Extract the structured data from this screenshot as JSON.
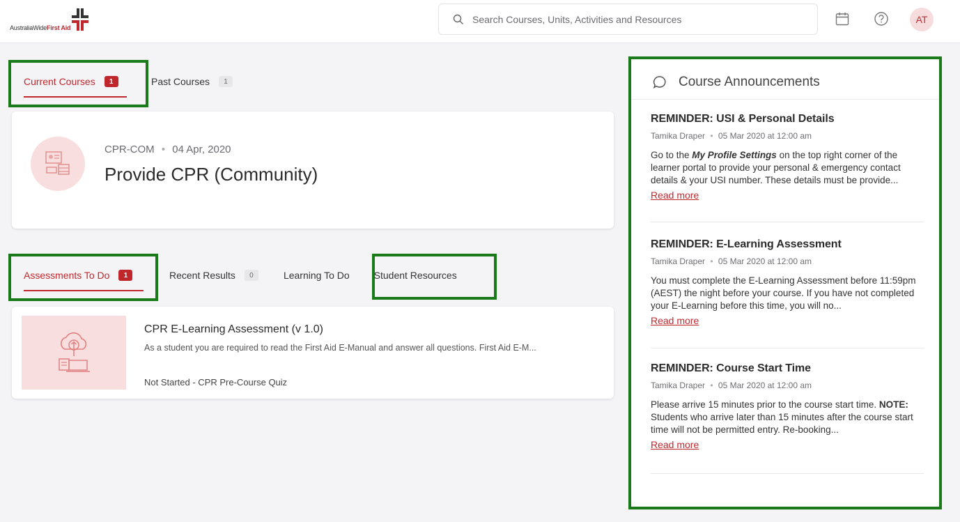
{
  "header": {
    "logo": {
      "text_prefix": "AustraliaWide",
      "text_suffix": "First Aid"
    },
    "search": {
      "placeholder": "Search Courses, Units, Activities and Resources"
    },
    "icons": [
      "calendar-icon",
      "help-icon"
    ],
    "avatar_initials": "AT"
  },
  "course_tabs": [
    {
      "label": "Current Courses",
      "badge": "1"
    },
    {
      "label": "Past Courses",
      "badge": "1"
    }
  ],
  "course": {
    "code": "CPR-COM",
    "date": "04 Apr, 2020",
    "title": "Provide CPR (Community)"
  },
  "activity_tabs": [
    {
      "label": "Assessments To Do",
      "badge": "1"
    },
    {
      "label": "Recent Results",
      "badge": "0"
    },
    {
      "label": "Learning To Do"
    },
    {
      "label": "Student Resources"
    }
  ],
  "assessment": {
    "title": "CPR E-Learning Assessment (v 1.0)",
    "description": "As a student you are required to read the First Aid E-Manual and answer all questions.   First Aid E-M...",
    "status": "Not Started - CPR Pre-Course Quiz"
  },
  "announcements": {
    "heading": "Course Announcements",
    "read_more": "Read more",
    "items": [
      {
        "title": "REMINDER: USI & Personal Details",
        "author": "Tamika Draper",
        "date": "05 Mar 2020 at 12:00 am",
        "body_pre": "Go to the ",
        "body_em": "My Profile Settings",
        "body_post": " on the top right corner of the learner portal to provide your personal & emergency contact details & your USI number.  These details must be provide..."
      },
      {
        "title": "REMINDER: E-Learning Assessment",
        "author": "Tamika Draper",
        "date": "05 Mar 2020 at 12:00 am",
        "body": "You must complete the E-Learning Assessment before 11:59pm (AEST) the night before your course.  If you have not completed your E-Learning before this time, you will no..."
      },
      {
        "title": "REMINDER: Course Start Time",
        "author": "Tamika Draper",
        "date": "05 Mar 2020 at 12:00 am",
        "body_pre": "Please arrive 15 minutes prior to the course start time.",
        "body_strong": "NOTE:",
        "body_post": " Students who arrive later than 15 minutes after the course start time will not be permitted entry. Re-booking..."
      }
    ]
  },
  "colors": {
    "accent": "#c0272d",
    "highlight": "#1a7a1a",
    "icon_bg": "#f8dede"
  }
}
